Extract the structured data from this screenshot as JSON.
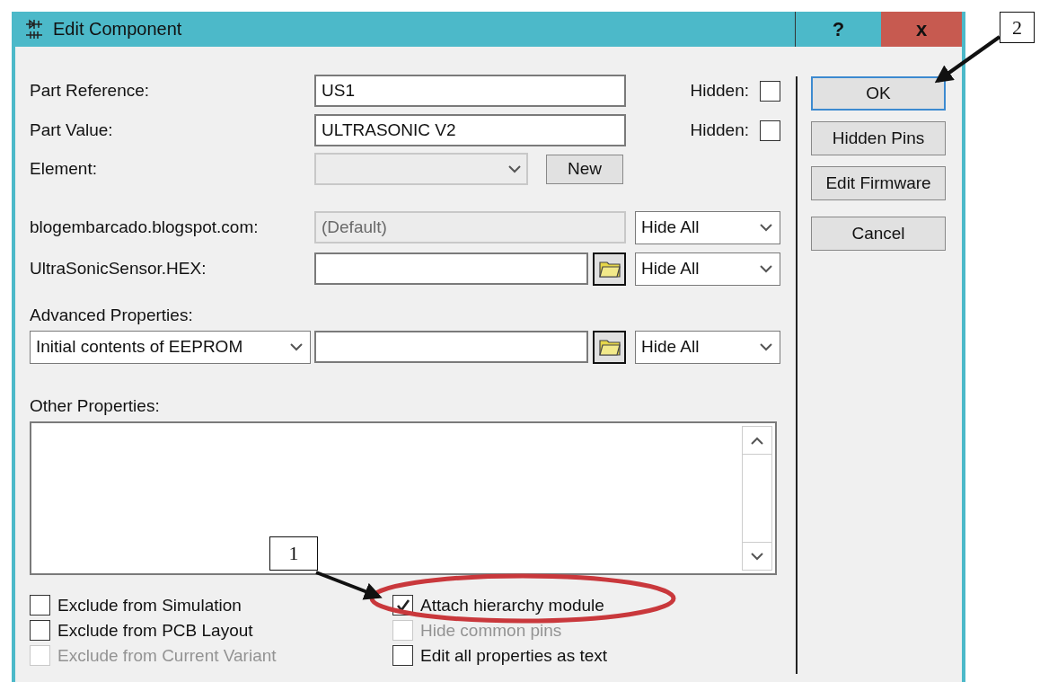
{
  "window": {
    "title": "Edit Component",
    "controls": [
      {
        "kind": "help",
        "label": "?"
      },
      {
        "kind": "close",
        "label": "x"
      }
    ]
  },
  "fields": [
    {
      "kind": "text",
      "label": "Part Reference:",
      "value": "US1",
      "hidden_label": "Hidden:",
      "hidden": false
    },
    {
      "kind": "text",
      "label": "Part Value:",
      "value": "ULTRASONIC V2",
      "hidden_label": "Hidden:",
      "hidden": false
    },
    {
      "kind": "combo",
      "label": "Element:",
      "disabled": true,
      "button": "New"
    },
    {
      "kind": "property",
      "label": "blogembarcado.blogspot.com:",
      "value": "(Default)",
      "disabled": true,
      "visibility": "Hide All"
    },
    {
      "kind": "file",
      "label": "UltraSonicSensor.HEX:",
      "disabled": false,
      "visibility": "Hide All"
    }
  ],
  "advanced": {
    "label": "Advanced Properties:",
    "property": "Initial contents of EEPROM",
    "visibility": "Hide All"
  },
  "other": {
    "label": "Other Properties:"
  },
  "options": [
    [
      {
        "label": "Exclude from Simulation",
        "checked": false,
        "disabled": false
      },
      {
        "label": "Exclude from PCB Layout",
        "checked": false,
        "disabled": false
      },
      {
        "label": "Exclude from Current Variant",
        "checked": false,
        "disabled": true
      }
    ],
    [
      {
        "label": "Attach hierarchy module",
        "checked": true,
        "disabled": false
      },
      {
        "label": "Hide common pins",
        "checked": false,
        "disabled": true
      },
      {
        "label": "Edit all properties as text",
        "checked": false,
        "disabled": false
      }
    ]
  ],
  "buttons": [
    {
      "label": "OK",
      "default": true
    },
    {
      "label": "Hidden Pins",
      "default": false
    },
    {
      "label": "Edit Firmware",
      "default": false
    },
    {
      "label": "Cancel",
      "default": false
    }
  ],
  "annotations": [
    {
      "label": "1"
    },
    {
      "label": "2"
    }
  ]
}
